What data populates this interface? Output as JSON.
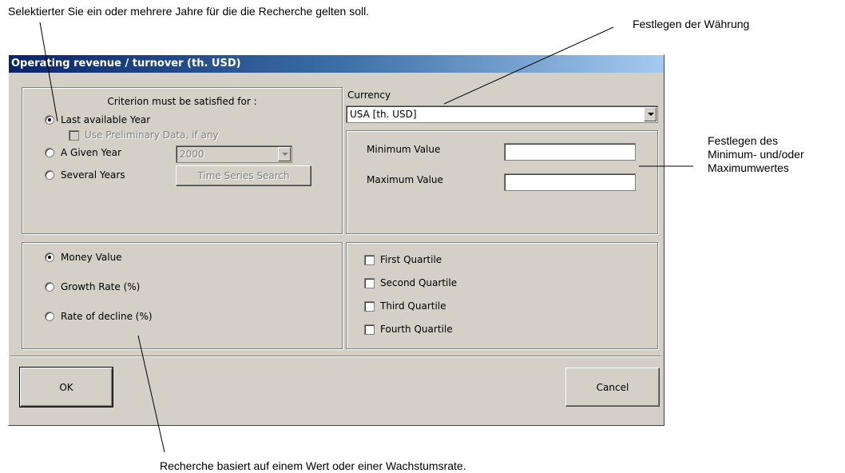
{
  "annotations": {
    "years_note": "Selektierter Sie ein oder mehrere Jahre für die die Recherche gelten soll.",
    "currency_note": "Festlegen der Währung",
    "minmax_note_1": "Festlegen des",
    "minmax_note_2": "Minimum- und/oder",
    "minmax_note_3": "Maximumwertes",
    "value_note": "Recherche basiert auf einem Wert oder einer Wachstumsrate."
  },
  "dialog": {
    "title": "Operating revenue / turnover (th. USD)",
    "criterion": {
      "heading": "Criterion must be satisfied for :",
      "last_year": "Last available Year",
      "preliminary": "Use Preliminary Data, if any",
      "given_year": "A Given Year",
      "given_year_value": "2000",
      "several_years": "Several Years",
      "time_series_button": "Time Series Search"
    },
    "currency": {
      "label": "Currency",
      "value": "USA [th. USD]"
    },
    "range": {
      "min_label": "Minimum Value",
      "min_value": "",
      "max_label": "Maximum Value",
      "max_value": ""
    },
    "value_type": {
      "money": "Money Value",
      "growth": "Growth Rate (%)",
      "decline": "Rate of decline (%)"
    },
    "quartiles": {
      "first": "First Quartile",
      "second": "Second Quartile",
      "third": "Third Quartile",
      "fourth": "Fourth Quartile"
    },
    "buttons": {
      "ok": "OK",
      "cancel": "Cancel"
    }
  }
}
